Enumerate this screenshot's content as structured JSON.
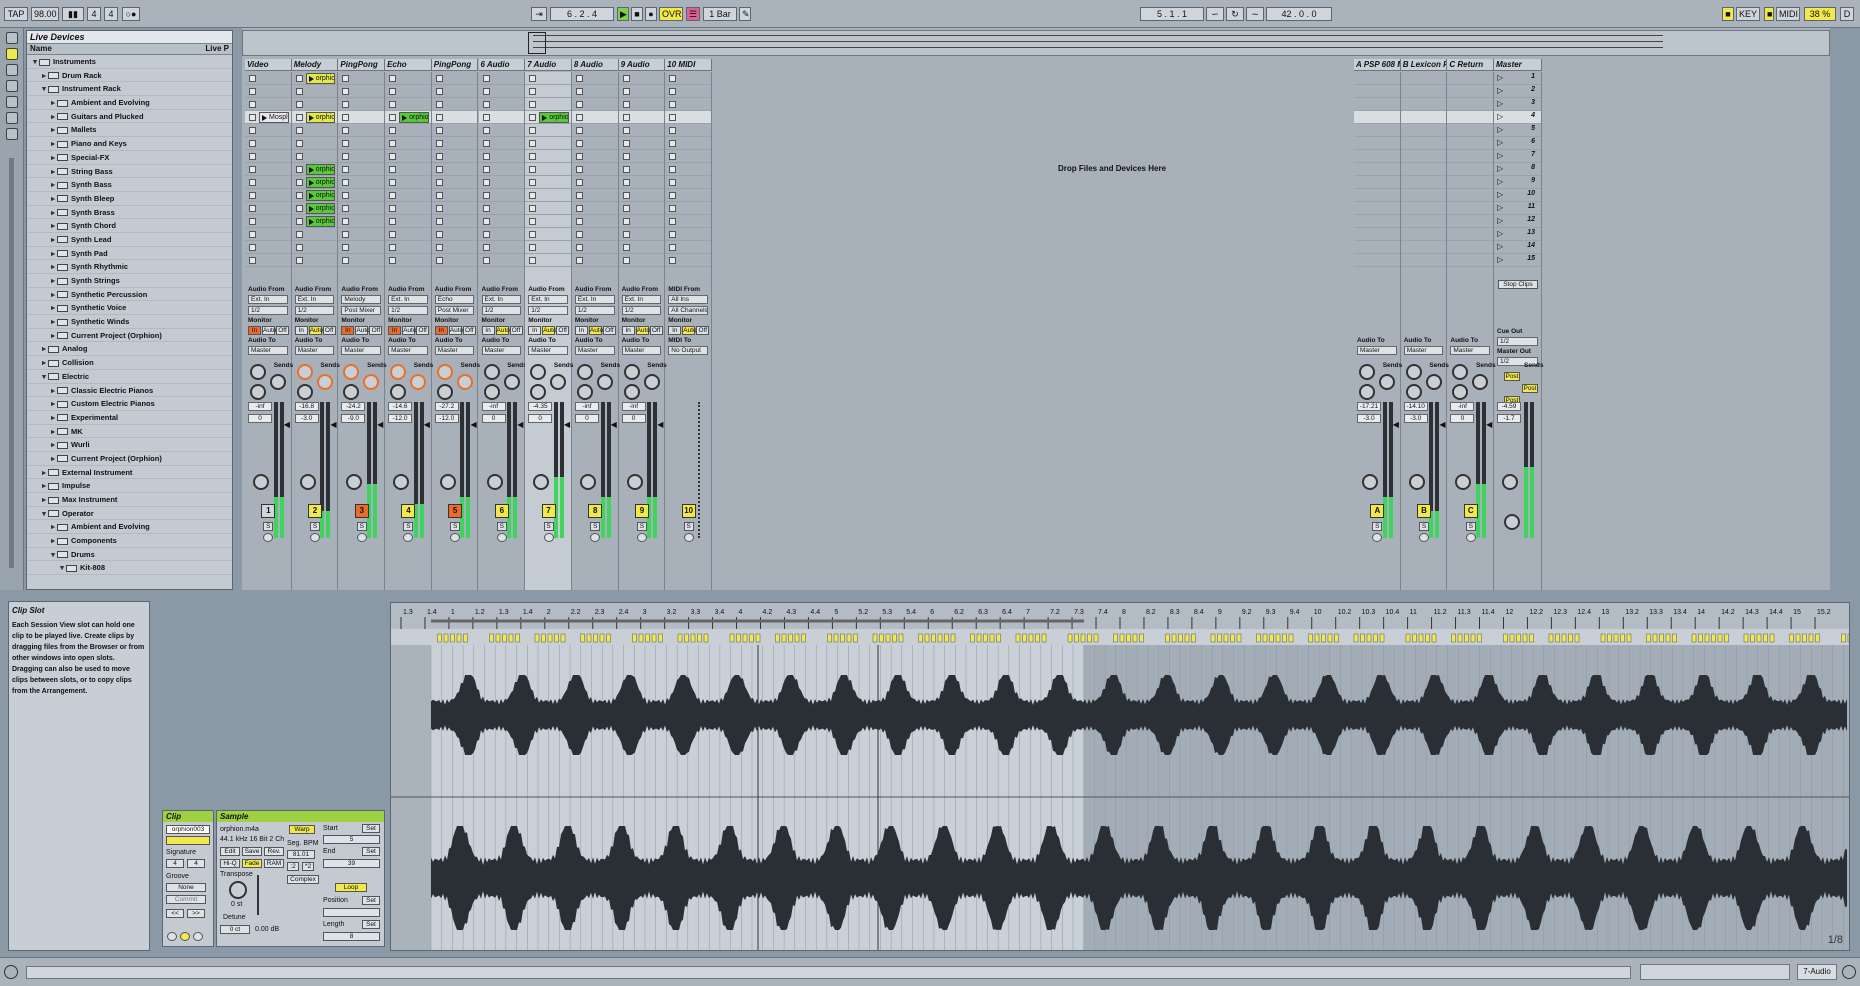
{
  "topbar": {
    "tap": "TAP",
    "tempo": "98.00",
    "signature_num": "4",
    "signature_den": "4",
    "position": "6 . 2 . 4",
    "ovr": "OVR",
    "quantize": "1 Bar",
    "loop_start": "5 . 1 . 1",
    "loop_length": "42 . 0 . 0",
    "key": "KEY",
    "midi": "MIDI",
    "cpu": "38 %",
    "disk": "D"
  },
  "browser": {
    "title": "Live Devices",
    "col_name": "Name",
    "col_live": "Live P",
    "items": [
      {
        "label": "Instruments",
        "indent": 0,
        "open": true
      },
      {
        "label": "Drum Rack",
        "indent": 1,
        "open": false
      },
      {
        "label": "Instrument Rack",
        "indent": 1,
        "open": true
      },
      {
        "label": "Ambient and Evolving",
        "indent": 2,
        "open": false
      },
      {
        "label": "Guitars and Plucked",
        "indent": 2,
        "open": false
      },
      {
        "label": "Mallets",
        "indent": 2,
        "open": false
      },
      {
        "label": "Piano and Keys",
        "indent": 2,
        "open": false
      },
      {
        "label": "Special-FX",
        "indent": 2,
        "open": false
      },
      {
        "label": "String Bass",
        "indent": 2,
        "open": false
      },
      {
        "label": "Synth Bass",
        "indent": 2,
        "open": false
      },
      {
        "label": "Synth Bleep",
        "indent": 2,
        "open": false
      },
      {
        "label": "Synth Brass",
        "indent": 2,
        "open": false
      },
      {
        "label": "Synth Chord",
        "indent": 2,
        "open": false
      },
      {
        "label": "Synth Lead",
        "indent": 2,
        "open": false
      },
      {
        "label": "Synth Pad",
        "indent": 2,
        "open": false
      },
      {
        "label": "Synth Rhythmic",
        "indent": 2,
        "open": false
      },
      {
        "label": "Synth Strings",
        "indent": 2,
        "open": false
      },
      {
        "label": "Synthetic Percussion",
        "indent": 2,
        "open": false
      },
      {
        "label": "Synthetic Voice",
        "indent": 2,
        "open": false
      },
      {
        "label": "Synthetic Winds",
        "indent": 2,
        "open": false
      },
      {
        "label": "Current Project (Orphion)",
        "indent": 2,
        "open": false
      },
      {
        "label": "Analog",
        "indent": 1,
        "open": false
      },
      {
        "label": "Collision",
        "indent": 1,
        "open": false
      },
      {
        "label": "Electric",
        "indent": 1,
        "open": true
      },
      {
        "label": "Classic Electric Pianos",
        "indent": 2,
        "open": false
      },
      {
        "label": "Custom Electric Pianos",
        "indent": 2,
        "open": false
      },
      {
        "label": "Experimental",
        "indent": 2,
        "open": false
      },
      {
        "label": "MK",
        "indent": 2,
        "open": false
      },
      {
        "label": "Wurli",
        "indent": 2,
        "open": false
      },
      {
        "label": "Current Project (Orphion)",
        "indent": 2,
        "open": false
      },
      {
        "label": "External Instrument",
        "indent": 1,
        "open": false
      },
      {
        "label": "Impulse",
        "indent": 1,
        "open": false
      },
      {
        "label": "Max Instrument",
        "indent": 1,
        "open": false
      },
      {
        "label": "Operator",
        "indent": 1,
        "open": true
      },
      {
        "label": "Ambient and Evolving",
        "indent": 2,
        "open": false
      },
      {
        "label": "Components",
        "indent": 2,
        "open": false
      },
      {
        "label": "Drums",
        "indent": 2,
        "open": true
      },
      {
        "label": "Kit-808",
        "indent": 3,
        "open": true
      }
    ]
  },
  "session": {
    "drop_text": "Drop Files and Devices Here",
    "tracks": [
      {
        "name": "Video",
        "num": "1",
        "vol": "-inf",
        "pan": "0",
        "from": "Ext. In",
        "from2": "1/2",
        "to": "Master",
        "monitor": "In",
        "num_color": "grey"
      },
      {
        "name": "Melody",
        "num": "2",
        "vol": "-16.8",
        "pan": "-3.0",
        "from": "Ext. In",
        "from2": "1/2",
        "to": "Master",
        "monitor": "Auto",
        "num_color": "yellow"
      },
      {
        "name": "PingPong",
        "num": "3",
        "vol": "-24.2",
        "pan": "-9.0",
        "from": "Melody",
        "from2": "Post Mixer",
        "to": "Master",
        "monitor": "In",
        "num_color": "orange"
      },
      {
        "name": "Echo",
        "num": "4",
        "vol": "-14.6",
        "pan": "-12.0",
        "from": "Ext. In",
        "from2": "1/2",
        "to": "Master",
        "monitor": "In",
        "num_color": "yellow"
      },
      {
        "name": "PingPong",
        "num": "5",
        "vol": "-27.2",
        "pan": "-12.0",
        "from": "Echo",
        "from2": "Post Mixer",
        "to": "Master",
        "monitor": "In",
        "num_color": "orange"
      },
      {
        "name": "6 Audio",
        "num": "6",
        "vol": "-inf",
        "pan": "0",
        "from": "Ext. In",
        "from2": "1/2",
        "to": "Master",
        "monitor": "Auto",
        "num_color": "yellow"
      },
      {
        "name": "7 Audio",
        "num": "7",
        "vol": "-4.35",
        "pan": "0",
        "from": "Ext. In",
        "from2": "1/2",
        "to": "Master",
        "monitor": "Auto",
        "num_color": "yellow"
      },
      {
        "name": "8 Audio",
        "num": "8",
        "vol": "-inf",
        "pan": "0",
        "from": "Ext. In",
        "from2": "1/2",
        "to": "Master",
        "monitor": "Auto",
        "num_color": "yellow"
      },
      {
        "name": "9 Audio",
        "num": "9",
        "vol": "-inf",
        "pan": "0",
        "from": "Ext. In",
        "from2": "1/2",
        "to": "Master",
        "monitor": "Auto",
        "num_color": "yellow"
      },
      {
        "name": "10 MIDI",
        "num": "10",
        "vol": "",
        "pan": "",
        "from": "All Ins",
        "from2": "All Channels",
        "to": "No Output",
        "monitor": "Auto",
        "num_color": "yellow"
      }
    ],
    "clips": [
      {
        "track": 1,
        "slot": 0,
        "label": "orphion001",
        "color": "yellow"
      },
      {
        "track": 0,
        "slot": 3,
        "label": "Mosplino004",
        "color": "grey"
      },
      {
        "track": 1,
        "slot": 3,
        "label": "orphion001",
        "color": "yellow"
      },
      {
        "track": 3,
        "slot": 3,
        "label": "orphion002",
        "color": "green"
      },
      {
        "track": 6,
        "slot": 3,
        "label": "orphion003",
        "color": "green"
      },
      {
        "track": 1,
        "slot": 7,
        "label": "orphion001",
        "color": "green"
      },
      {
        "track": 1,
        "slot": 8,
        "label": "orphion002",
        "color": "green"
      },
      {
        "track": 1,
        "slot": 9,
        "label": "orphion003",
        "color": "green"
      },
      {
        "track": 1,
        "slot": 10,
        "label": "orphion04",
        "color": "green"
      },
      {
        "track": 1,
        "slot": 11,
        "label": "orphion05",
        "color": "green"
      }
    ],
    "returns": [
      {
        "name": "A PSP 608 M",
        "letter": "A",
        "vol": "-17.21",
        "pan": "-3.0",
        "to": "Master"
      },
      {
        "name": "B Lexicon P",
        "letter": "B",
        "vol": "-14.10",
        "pan": "-3.0",
        "to": "Master"
      },
      {
        "name": "C Return",
        "letter": "C",
        "vol": "-inf",
        "pan": "0",
        "to": "Master"
      }
    ],
    "master": {
      "name": "Master",
      "vol": "-4.59",
      "pan": "-1.7",
      "cue_out": "1/2",
      "master_out": "1/2",
      "stop_clips": "Stop Clips",
      "cue_out_label": "Cue Out",
      "master_out_label": "Master Out"
    },
    "scenes": [
      "1",
      "2",
      "3",
      "4",
      "5",
      "6",
      "7",
      "8",
      "9",
      "10",
      "11",
      "12",
      "13",
      "14",
      "15"
    ],
    "labels": {
      "audio_from": "Audio From",
      "midi_from": "MIDI From",
      "monitor": "Monitor",
      "audio_to": "Audio To",
      "midi_to": "MIDI To",
      "sends": "Sends",
      "in": "In",
      "auto": "Auto",
      "off": "Off",
      "post": "Post"
    }
  },
  "info": {
    "title": "Clip Slot",
    "text": "Each Session View slot can hold one clip to be played live. Create clips by dragging files from the Browser or from other windows into open slots. Dragging can also be used to move clips between slots, or to copy clips from the Arrangement."
  },
  "clip": {
    "title": "Clip",
    "name": "orphion003",
    "signature_label": "Signature",
    "sig_num": "4",
    "sig_den": "4",
    "groove_label": "Groove",
    "groove": "None",
    "commit": "Commit"
  },
  "sample": {
    "title": "Sample",
    "file": "orphion.m4a",
    "info": "44.1 kHz 16 Bit 2 Ch",
    "edit": "Edit",
    "save": "Save",
    "rev": "Rev.",
    "hiq": "Hi-Q",
    "fade": "Fade",
    "ram": "RAM",
    "warp": "Warp",
    "seg_bpm_label": "Seg. BPM",
    "seg_bpm": "81.01",
    "half": ":2",
    "double": "*2",
    "mode": "Complex",
    "transpose_label": "Transpose",
    "transpose": "0 st",
    "detune_label": "Detune",
    "detune": "0 ct",
    "gain": "0.00 dB",
    "start_label": "Start",
    "end_label": "End",
    "loop": "Loop",
    "position_label": "Position",
    "length_label": "Length",
    "set": "Set",
    "start_val": "5",
    "end_val": "39",
    "length_val": "8"
  },
  "waveform": {
    "ruler": [
      "1.3",
      "1.4",
      "1",
      "1.2",
      "1.3",
      "1.4",
      "2",
      "2.2",
      "2.3",
      "2.4",
      "3",
      "3.2",
      "3.3",
      "3.4",
      "4",
      "4.2",
      "4.3",
      "4.4",
      "5",
      "5.2",
      "5.3",
      "5.4",
      "6",
      "6.2",
      "6.3",
      "6.4",
      "7",
      "7.2",
      "7.3",
      "7.4",
      "8",
      "8.2",
      "8.3",
      "8.4",
      "9",
      "9.2",
      "9.3",
      "9.4",
      "10",
      "10.2",
      "10.3",
      "10.4",
      "11",
      "11.2",
      "11.3",
      "11.4",
      "12",
      "12.2",
      "12.3",
      "12.4",
      "13",
      "13.2",
      "13.3",
      "13.4",
      "14",
      "14.2",
      "14.3",
      "14.4",
      "15",
      "15.2"
    ],
    "zoom": "1/8"
  },
  "status": {
    "track": "7-Audio"
  }
}
